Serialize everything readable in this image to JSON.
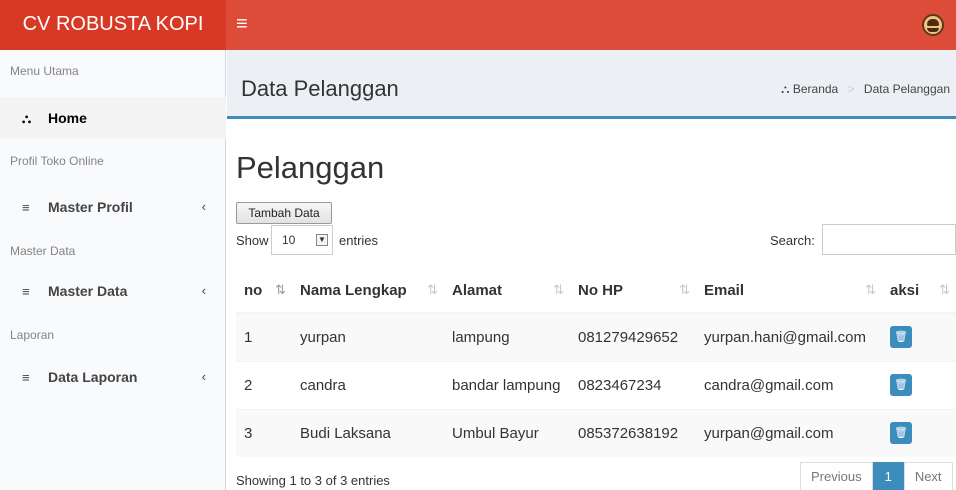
{
  "app": {
    "brand": "CV ROBUSTA KOPI",
    "menu_toggle_icon": "hamburger-icon",
    "accent_color": "#dd4b39",
    "primary_color": "#3c8dbc"
  },
  "sidebar": {
    "headers": [
      "Menu Utama",
      "Profil Toko Online",
      "Master Data",
      "Laporan"
    ],
    "items": [
      {
        "label": "Home",
        "icon": "dashboard-icon"
      },
      {
        "label": "Master Profil",
        "icon": "database-icon",
        "chevron": "‹"
      },
      {
        "label": "Master Data",
        "icon": "database-icon",
        "chevron": "‹"
      },
      {
        "label": "Data Laporan",
        "icon": "database-icon",
        "chevron": "‹"
      }
    ]
  },
  "content": {
    "title": "Data Pelanggan",
    "breadcrumb": [
      "Beranda",
      "Data Pelanggan"
    ],
    "box_title": "Pelanggan",
    "add_button": "Tambah Data",
    "show_label": "Show",
    "page_length": "10",
    "entries_label": "entries",
    "search_label": "Search:",
    "search_value": ""
  },
  "table": {
    "columns": [
      "no",
      "Nama Lengkap",
      "Alamat",
      "No HP",
      "Email",
      "aksi"
    ],
    "rows": [
      {
        "no": "1",
        "nama": "yurpan",
        "alamat": "lampung",
        "hp": "081279429652",
        "email": "yurpan.hani@gmail.com"
      },
      {
        "no": "2",
        "nama": "candra",
        "alamat": "bandar lampung",
        "hp": "0823467234",
        "email": "candra@gmail.com"
      },
      {
        "no": "3",
        "nama": "Budi Laksana",
        "alamat": "Umbul Bayur",
        "hp": "085372638192",
        "email": "yurpan@gmail.com"
      }
    ]
  },
  "footer": {
    "info": "Showing 1 to 3 of 3 entries",
    "pager": {
      "previous": "Previous",
      "current": "1",
      "next": "Next"
    }
  }
}
